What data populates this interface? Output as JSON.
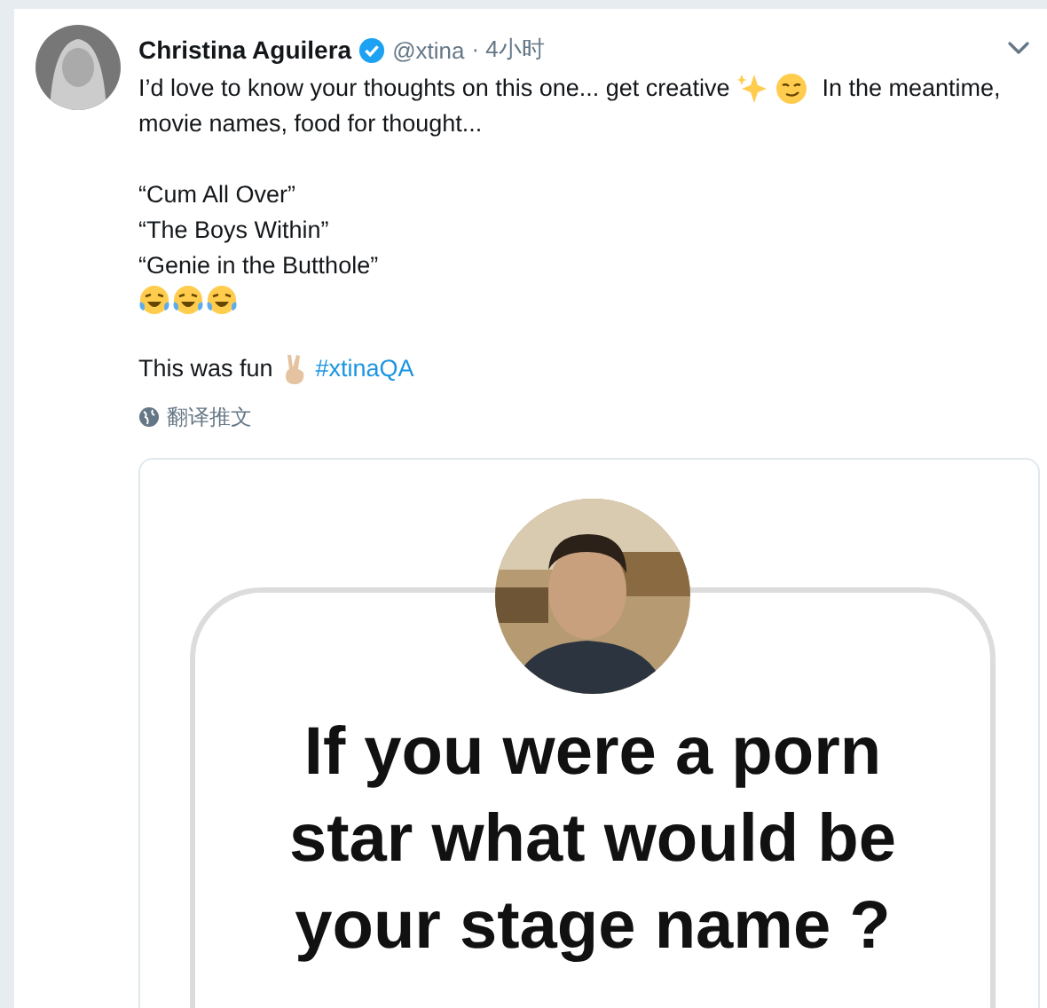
{
  "tweet": {
    "author": "Christina Aguilera",
    "verified": true,
    "handle": "@xtina",
    "time": "· 4小时",
    "lines": [
      {
        "kind": "text",
        "text": "I’d love to know your thoughts on this one... get creative"
      },
      {
        "kind": "text",
        "text": "In the meantime,"
      },
      {
        "kind": "text",
        "text": "movie names, food for thought..."
      },
      {
        "kind": "gap"
      },
      {
        "kind": "text",
        "text": "“Cum All Over”"
      },
      {
        "kind": "text",
        "text": "“The Boys Within”"
      },
      {
        "kind": "text",
        "text": "“Genie in the Butthole”"
      },
      {
        "kind": "laughs"
      },
      {
        "kind": "gap"
      },
      {
        "kind": "fun",
        "text": "This was fun",
        "hashtag": "#xtinaQA"
      }
    ],
    "translate": "翻译推文",
    "card": {
      "heading": [
        "If you were a porn",
        "star what would be",
        "your stage name ?"
      ]
    }
  }
}
